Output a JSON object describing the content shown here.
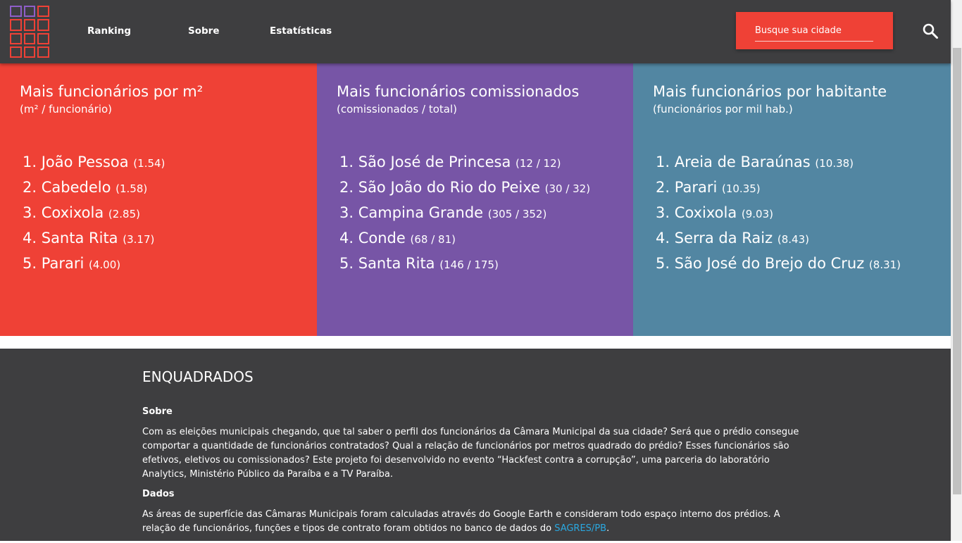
{
  "header": {
    "logo_text": "ENQUADRADOS",
    "nav": [
      "Ranking",
      "Sobre",
      "Estatísticas"
    ],
    "search_placeholder": "Busque sua cidade",
    "search_icon": "search-icon"
  },
  "panels": [
    {
      "color": "#ef4136",
      "title": "Mais funcionários por m²",
      "subtitle": "(m² / funcionário)",
      "items": [
        {
          "rank": "1.",
          "name": "João Pessoa",
          "value": "(1.54)"
        },
        {
          "rank": "2.",
          "name": "Cabedelo",
          "value": "(1.58)"
        },
        {
          "rank": "3.",
          "name": "Coxixola",
          "value": "(2.85)"
        },
        {
          "rank": "4.",
          "name": "Santa Rita",
          "value": "(3.17)"
        },
        {
          "rank": "5.",
          "name": "Parari",
          "value": "(4.00)"
        }
      ]
    },
    {
      "color": "#7755a6",
      "title": "Mais funcionários comissionados",
      "subtitle": "(comissionados / total)",
      "items": [
        {
          "rank": "1.",
          "name": "São José de Princesa",
          "value": "(12 / 12)"
        },
        {
          "rank": "2.",
          "name": "São João do Rio do Peixe",
          "value": "(30 / 32)"
        },
        {
          "rank": "3.",
          "name": "Campina Grande",
          "value": "(305 / 352)"
        },
        {
          "rank": "4.",
          "name": "Conde",
          "value": "(68 / 81)"
        },
        {
          "rank": "5.",
          "name": "Santa Rita",
          "value": "(146 / 175)"
        }
      ]
    },
    {
      "color": "#5286a2",
      "title": "Mais funcionários por habitante",
      "subtitle": "(funcionários por mil hab.)",
      "items": [
        {
          "rank": "1.",
          "name": "Areia de Baraúnas",
          "value": "(10.38)"
        },
        {
          "rank": "2.",
          "name": "Parari",
          "value": "(10.35)"
        },
        {
          "rank": "3.",
          "name": "Coxixola",
          "value": "(9.03)"
        },
        {
          "rank": "4.",
          "name": "Serra da Raiz",
          "value": "(8.43)"
        },
        {
          "rank": "5.",
          "name": "São José do Brejo do Cruz",
          "value": "(8.31)"
        }
      ]
    }
  ],
  "footer": {
    "title": "ENQUADRADOS",
    "sobre_heading": "Sobre",
    "sobre_text": "Com as eleições municipais chegando, que tal saber o perfil dos funcionários da Câmara Municipal da sua cidade? Será que o prédio consegue comportar a quantidade de funcionários contratados? Qual a relação de funcionários por metros quadrado do prédio? Esses funcionários são efetivos, eletivos ou comissionados? Este projeto foi desenvolvido no evento “Hackfest contra a corrupção”, uma parceria do laboratório Analytics, Ministério Público da Paraíba e a TV Paraíba.",
    "dados_heading": "Dados",
    "dados_text": "As áreas de superfície das Câmaras Municipais foram calculadas através do Google Earth e consideram todo espaço interno dos prédios. A relação de funcionários, funções e tipos de contrato foram obtidos no banco de dados do ",
    "dados_link": "SAGRES/PB",
    "dados_end": "."
  }
}
